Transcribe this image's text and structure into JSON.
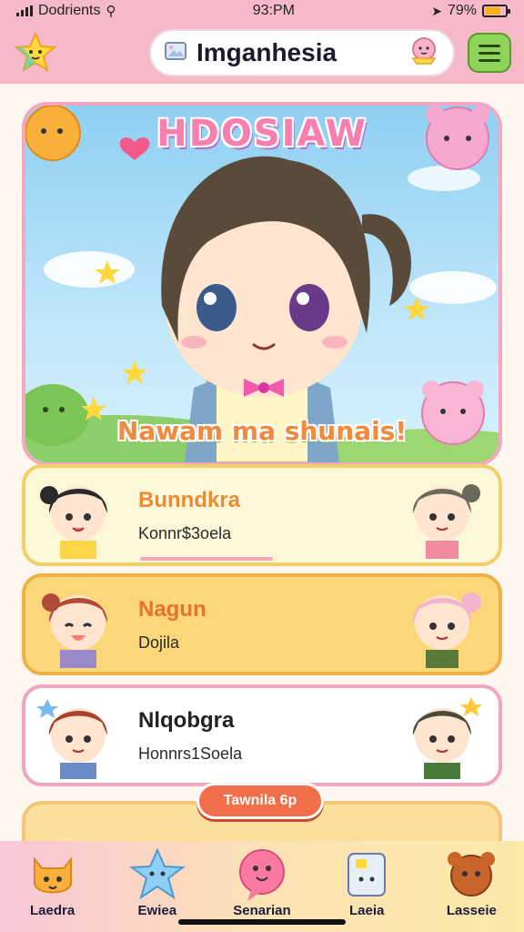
{
  "status_bar": {
    "carrier": "Dodrients",
    "time": "93:PM",
    "battery": "79%",
    "battery_level": 0.79
  },
  "header": {
    "app_title": "Imganhesia",
    "menu_icon": "hamburger-icon",
    "star_icon": "star-icon"
  },
  "hero": {
    "title": "HDOSIAW",
    "subtitle": "Nawam ma shunais!"
  },
  "cards": [
    {
      "name": "Bunndkra",
      "subtitle": "Konnr$3oela"
    },
    {
      "name": "Nagun",
      "subtitle": "Dojila"
    },
    {
      "name": "Nlqobgra",
      "subtitle": "Honnrs1Soela"
    }
  ],
  "floating_button": {
    "label": "Tawnila 6p"
  },
  "bottom_nav": [
    {
      "label": "Laedra",
      "icon": "cat-icon"
    },
    {
      "label": "Ewiea",
      "icon": "star-icon"
    },
    {
      "label": "Senarian",
      "icon": "chat-bubble-icon"
    },
    {
      "label": "Laeia",
      "icon": "notebook-icon"
    },
    {
      "label": "Lasseie",
      "icon": "bear-icon"
    }
  ],
  "colors": {
    "header_pink": "#f6b9c8",
    "menu_green": "#8fd45a",
    "accent_orange": "#f36f4a",
    "card_yellow": "#fbd77a"
  }
}
